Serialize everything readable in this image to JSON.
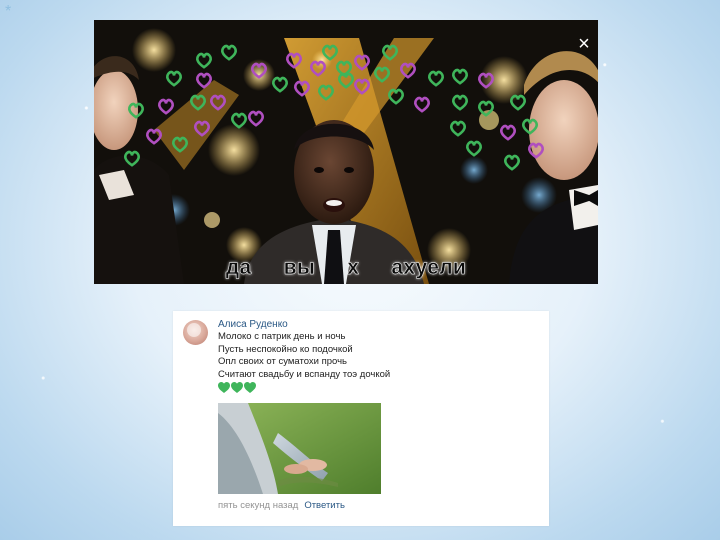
{
  "slide": {
    "corner_mark": "*"
  },
  "meme": {
    "caption": "да вы х ахуели",
    "close_glyph": "×",
    "heart_colors": {
      "green": "#3fb55b",
      "purple": "#b04fc0"
    }
  },
  "comment": {
    "author": "Алиса Руденко",
    "lines": [
      "Молоко с патрик день и ночь",
      "Пусть неспокойно ко подочкой",
      "Опл своих от суматохи прочь",
      "Считают свадьбу и вспанду тоэ дочкой"
    ],
    "emoji": [
      "green-heart",
      "green-heart",
      "green-heart"
    ],
    "emoji_color": "#3fb55b",
    "timestamp": "пять секунд назад",
    "reply_label": "Ответить",
    "link_color": "#2a5885"
  }
}
